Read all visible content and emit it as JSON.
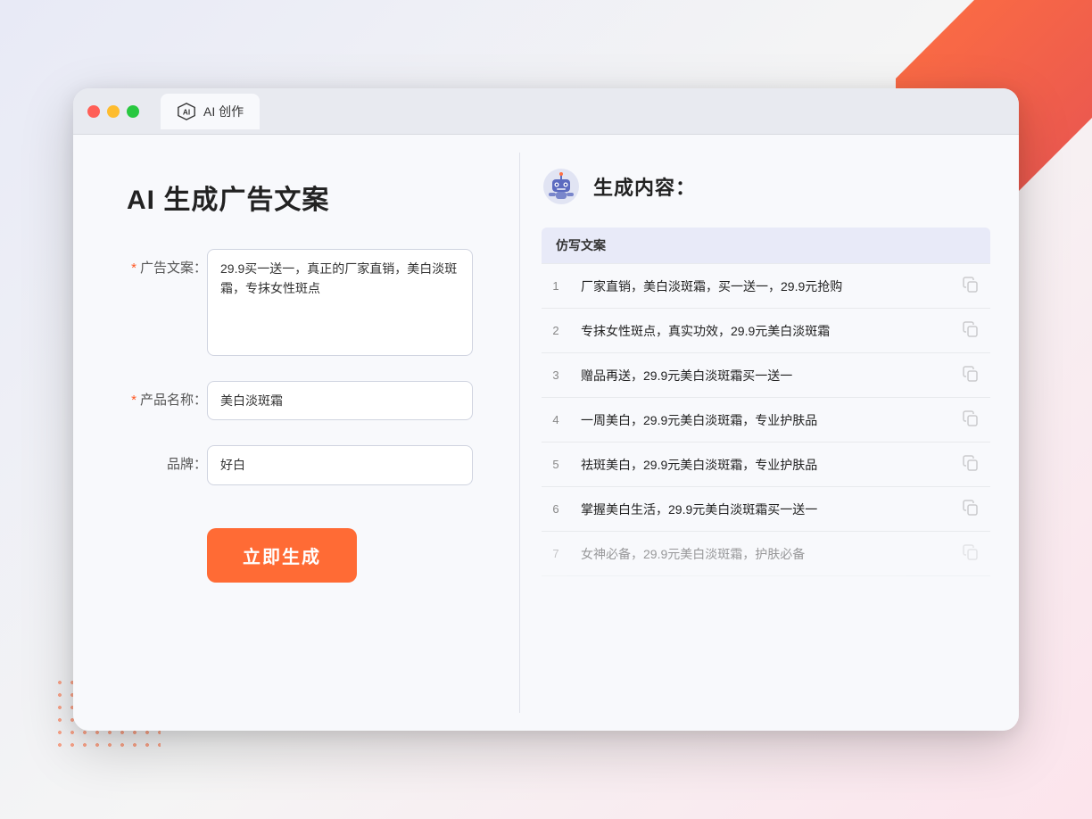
{
  "window": {
    "title": "AI 创作",
    "buttons": {
      "close": "close",
      "minimize": "minimize",
      "maximize": "maximize"
    }
  },
  "page": {
    "title": "AI 生成广告文案"
  },
  "form": {
    "ad_copy_label": "广告文案：",
    "ad_copy_required": "*",
    "ad_copy_value": "29.9买一送一，真正的厂家直销，美白淡斑霜，专抹女性斑点",
    "product_name_label": "产品名称：",
    "product_name_required": "*",
    "product_name_value": "美白淡斑霜",
    "brand_label": "品牌：",
    "brand_value": "好白",
    "generate_btn": "立即生成"
  },
  "result": {
    "header_title": "生成内容：",
    "table_header": "仿写文案",
    "items": [
      {
        "id": 1,
        "text": "厂家直销，美白淡斑霜，买一送一，29.9元抢购"
      },
      {
        "id": 2,
        "text": "专抹女性斑点，真实功效，29.9元美白淡斑霜"
      },
      {
        "id": 3,
        "text": "赠品再送，29.9元美白淡斑霜买一送一"
      },
      {
        "id": 4,
        "text": "一周美白，29.9元美白淡斑霜，专业护肤品"
      },
      {
        "id": 5,
        "text": "祛斑美白，29.9元美白淡斑霜，专业护肤品"
      },
      {
        "id": 6,
        "text": "掌握美白生活，29.9元美白淡斑霜买一送一"
      },
      {
        "id": 7,
        "text": "女神必备，29.9元美白淡斑霜，护肤必备"
      }
    ]
  }
}
